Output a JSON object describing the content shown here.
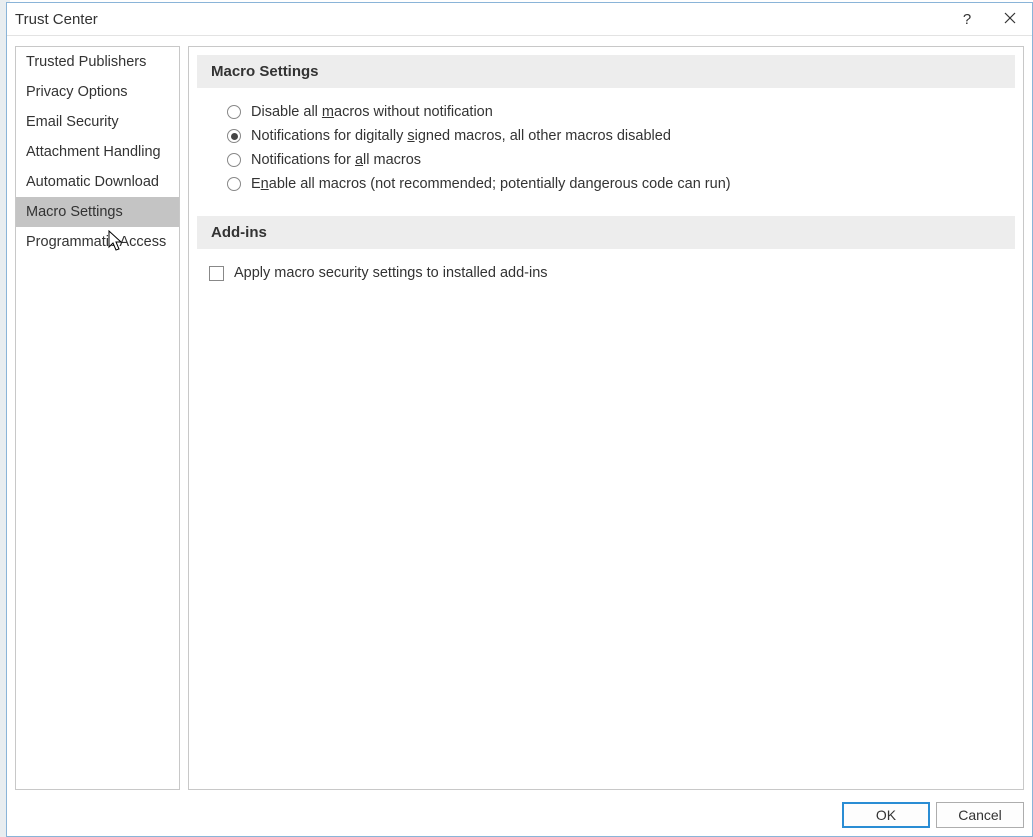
{
  "dialog": {
    "title": "Trust Center"
  },
  "sidebar": {
    "items": [
      {
        "label": "Trusted Publishers",
        "selected": false
      },
      {
        "label": "Privacy Options",
        "selected": false
      },
      {
        "label": "Email Security",
        "selected": false
      },
      {
        "label": "Attachment Handling",
        "selected": false
      },
      {
        "label": "Automatic Download",
        "selected": false
      },
      {
        "label": "Macro Settings",
        "selected": true
      },
      {
        "label": "Programmatic Access",
        "selected": false
      }
    ]
  },
  "content": {
    "section1_title": "Macro Settings",
    "radios": [
      {
        "pre": "Disable all ",
        "mnemonic": "m",
        "post": "acros without notification",
        "selected": false
      },
      {
        "pre": "Notifications for digitally ",
        "mnemonic": "s",
        "post": "igned macros, all other macros disabled",
        "selected": true
      },
      {
        "pre": "Notifications for ",
        "mnemonic": "a",
        "post": "ll macros",
        "selected": false
      },
      {
        "pre": "E",
        "mnemonic": "n",
        "post": "able all macros (not recommended; potentially dangerous code can run)",
        "selected": false
      }
    ],
    "section2_title": "Add-ins",
    "checkbox_label": "Apply macro security settings to installed add-ins",
    "checkbox_checked": false
  },
  "footer": {
    "ok": "OK",
    "cancel": "Cancel"
  }
}
